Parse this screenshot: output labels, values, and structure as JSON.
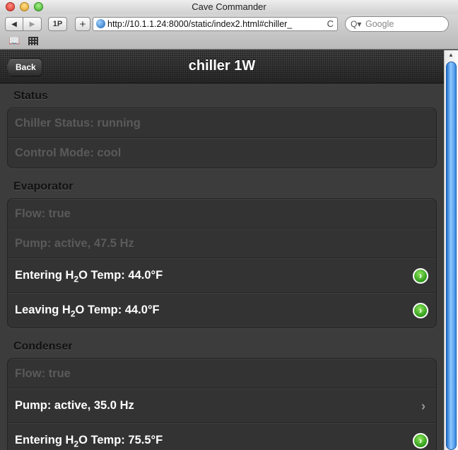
{
  "window": {
    "title": "Cave Commander",
    "back_arrow": "◀",
    "forward_arrow": "▶",
    "btn_1p": "1P",
    "btn_plus": "+",
    "url": "http://10.1.1.24:8000/static/index2.html#chiller_",
    "reload_glyph": "C",
    "search_placeholder": "Google",
    "search_glyph": "Q▾",
    "bookmarks_glyph": "📖"
  },
  "app": {
    "back_label": "Back",
    "title": "chiller 1W"
  },
  "sections": [
    {
      "title": "Status",
      "rows": [
        {
          "pre": "Chiller Status: running",
          "sub": "",
          "post": "",
          "state": "disabled",
          "accessory": "none"
        },
        {
          "pre": "Control Mode: cool",
          "sub": "",
          "post": "",
          "state": "disabled",
          "accessory": "none"
        }
      ]
    },
    {
      "title": "Evaporator",
      "rows": [
        {
          "pre": "Flow: true",
          "sub": "",
          "post": "",
          "state": "disabled",
          "accessory": "none"
        },
        {
          "pre": "Pump: active, 47.5 Hz",
          "sub": "",
          "post": "",
          "state": "disabled",
          "accessory": "none"
        },
        {
          "pre": "Entering H",
          "sub": "2",
          "post": "O Temp: 44.0°F",
          "state": "active",
          "accessory": "go"
        },
        {
          "pre": "Leaving H",
          "sub": "2",
          "post": "O Temp: 44.0°F",
          "state": "active",
          "accessory": "go"
        }
      ]
    },
    {
      "title": "Condenser",
      "rows": [
        {
          "pre": "Flow: true",
          "sub": "",
          "post": "",
          "state": "disabled",
          "accessory": "none"
        },
        {
          "pre": "Pump: active, 35.0 Hz",
          "sub": "",
          "post": "",
          "state": "active",
          "accessory": "chevron"
        },
        {
          "pre": "Entering H",
          "sub": "2",
          "post": "O Temp: 75.5°F",
          "state": "active",
          "accessory": "go"
        }
      ]
    }
  ],
  "glyphs": {
    "go": "›",
    "chevron": "›"
  },
  "colors": {
    "go_green": "#3fae2b",
    "disabled_text": "#5a5a5a",
    "scroll_blue": "#2f80d8"
  }
}
